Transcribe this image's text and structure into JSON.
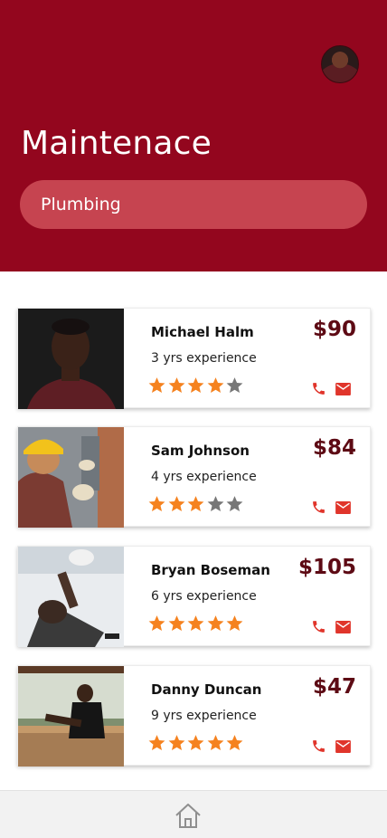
{
  "header": {
    "title": "Maintenace",
    "category": "Plumbing",
    "avatar_icon": "user-avatar"
  },
  "colors": {
    "header_bg": "#93061e",
    "pill_bg": "#c64450",
    "price": "#5d0a14",
    "star_on": "#f5821f",
    "star_off": "#777777",
    "action_icons": "#e0352b"
  },
  "providers": [
    {
      "name": "Michael Halm",
      "experience": "3 yrs experience",
      "price": "$90",
      "rating": 4
    },
    {
      "name": "Sam Johnson",
      "experience": "4 yrs experience",
      "price": "$84",
      "rating": 3
    },
    {
      "name": "Bryan Boseman",
      "experience": "6 yrs experience",
      "price": "$105",
      "rating": 5
    },
    {
      "name": "Danny Duncan",
      "experience": "9 yrs experience",
      "price": "$47",
      "rating": 5
    }
  ],
  "nav": {
    "home_icon": "home-icon"
  }
}
